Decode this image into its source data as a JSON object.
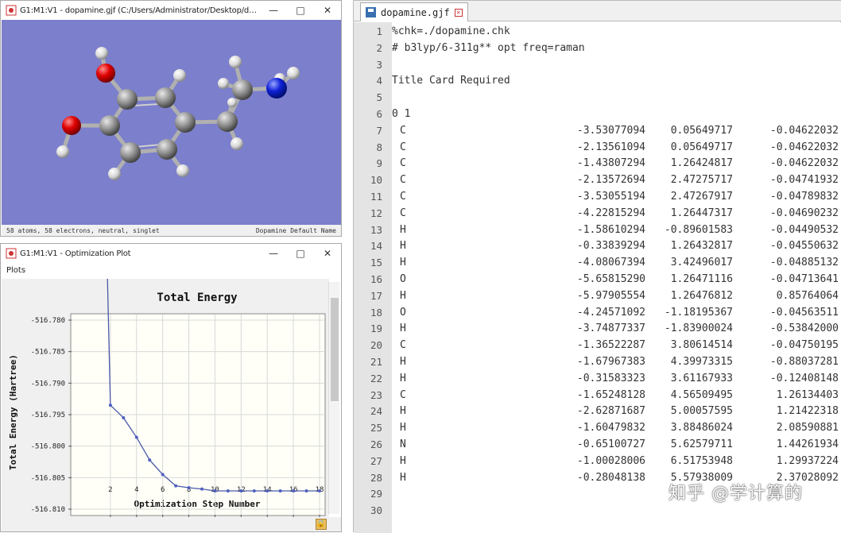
{
  "viewer_window": {
    "title": "G1:M1:V1 - dopamine.gjf (C:/Users/Administrator/Desktop/dopamine...",
    "status_left": "58 atoms, 58 electrons, neutral, singlet",
    "status_right": "Dopamine Default Name"
  },
  "plot_window": {
    "title": "G1:M1:V1 - Optimization Plot",
    "menu": "Plots",
    "lock_label": "🔒"
  },
  "chart_data": {
    "type": "line",
    "title": "Total Energy",
    "xlabel": "Optimization Step Number",
    "ylabel": "Total Energy (Hartree)",
    "x": [
      1,
      2,
      3,
      4,
      5,
      6,
      7,
      8,
      9,
      10,
      11,
      12,
      13,
      14,
      15,
      16,
      17,
      18
    ],
    "values": [
      -516.704,
      -516.7935,
      -516.7955,
      -516.7986,
      -516.8022,
      -516.8045,
      -516.8063,
      -516.8066,
      -516.8068,
      -516.8071,
      -516.8071,
      -516.8071,
      -516.8071,
      -516.8071,
      -516.8071,
      -516.8071,
      -516.8071,
      -516.8071
    ],
    "ylim": [
      -516.81,
      -516.78
    ],
    "xlim": [
      0,
      18
    ],
    "ytick_labels": [
      "-516.780",
      "-516.785",
      "-516.790",
      "-516.795",
      "-516.800",
      "-516.805",
      "-516.810"
    ],
    "yticks": [
      -516.78,
      -516.785,
      -516.79,
      -516.795,
      -516.8,
      -516.805,
      -516.81
    ],
    "xticks": [
      2,
      4,
      6,
      8,
      10,
      12,
      14,
      16,
      18
    ],
    "xtick_labels": [
      "2",
      "4",
      "6",
      "8",
      "10",
      "12",
      "14",
      "16",
      "18"
    ],
    "grid": true,
    "colors": {
      "line": "#4a5aa8",
      "highlight": "#e060a0",
      "marker": "#5060c0"
    }
  },
  "editor": {
    "tab_label": "dopamine.gjf",
    "lines": [
      {
        "n": "1",
        "text": "%chk=./dopamine.chk"
      },
      {
        "n": "2",
        "text": "# b3lyp/6-311g** opt freq=raman"
      },
      {
        "n": "3",
        "text": ""
      },
      {
        "n": "4",
        "text": "Title Card Required"
      },
      {
        "n": "5",
        "text": ""
      },
      {
        "n": "6",
        "text": "0 1"
      },
      {
        "n": "7",
        "el": "C",
        "x": "-3.53077094",
        "y": "0.05649717",
        "z": "-0.04622032"
      },
      {
        "n": "8",
        "el": "C",
        "x": "-2.13561094",
        "y": "0.05649717",
        "z": "-0.04622032"
      },
      {
        "n": "9",
        "el": "C",
        "x": "-1.43807294",
        "y": "1.26424817",
        "z": "-0.04622032"
      },
      {
        "n": "10",
        "el": "C",
        "x": "-2.13572694",
        "y": "2.47275717",
        "z": "-0.04741932"
      },
      {
        "n": "11",
        "el": "C",
        "x": "-3.53055194",
        "y": "2.47267917",
        "z": "-0.04789832"
      },
      {
        "n": "12",
        "el": "C",
        "x": "-4.22815294",
        "y": "1.26447317",
        "z": "-0.04690232"
      },
      {
        "n": "13",
        "el": "H",
        "x": "-1.58610294",
        "y": "-0.89601583",
        "z": "-0.04490532"
      },
      {
        "n": "14",
        "el": "H",
        "x": "-0.33839294",
        "y": "1.26432817",
        "z": "-0.04550632"
      },
      {
        "n": "15",
        "el": "H",
        "x": "-4.08067394",
        "y": "3.42496017",
        "z": "-0.04885132"
      },
      {
        "n": "16",
        "el": "O",
        "x": "-5.65815290",
        "y": "1.26471116",
        "z": "-0.04713641"
      },
      {
        "n": "17",
        "el": "H",
        "x": "-5.97905554",
        "y": "1.26476812",
        "z": "0.85764064"
      },
      {
        "n": "18",
        "el": "O",
        "x": "-4.24571092",
        "y": "-1.18195367",
        "z": "-0.04563511"
      },
      {
        "n": "19",
        "el": "H",
        "x": "-3.74877337",
        "y": "-1.83900024",
        "z": "-0.53842000"
      },
      {
        "n": "20",
        "el": "C",
        "x": "-1.36522287",
        "y": "3.80614514",
        "z": "-0.04750195"
      },
      {
        "n": "21",
        "el": "H",
        "x": "-1.67967383",
        "y": "4.39973315",
        "z": "-0.88037281"
      },
      {
        "n": "22",
        "el": "H",
        "x": "-0.31583323",
        "y": "3.61167933",
        "z": "-0.12408148"
      },
      {
        "n": "23",
        "el": "C",
        "x": "-1.65248128",
        "y": "4.56509495",
        "z": "1.26134403"
      },
      {
        "n": "24",
        "el": "H",
        "x": "-2.62871687",
        "y": "5.00057595",
        "z": "1.21422318"
      },
      {
        "n": "25",
        "el": "H",
        "x": "-1.60479832",
        "y": "3.88486024",
        "z": "2.08590881"
      },
      {
        "n": "26",
        "el": "N",
        "x": "-0.65100727",
        "y": "5.62579711",
        "z": "1.44261934"
      },
      {
        "n": "27",
        "el": "H",
        "x": "-1.00028006",
        "y": "6.51753948",
        "z": "1.29937224"
      },
      {
        "n": "28",
        "el": "H",
        "x": "-0.28048138",
        "y": "5.57938009",
        "z": "2.37028092"
      },
      {
        "n": "29",
        "text": ""
      },
      {
        "n": "30",
        "text": ""
      }
    ]
  },
  "watermark": "知乎 @学计算的"
}
